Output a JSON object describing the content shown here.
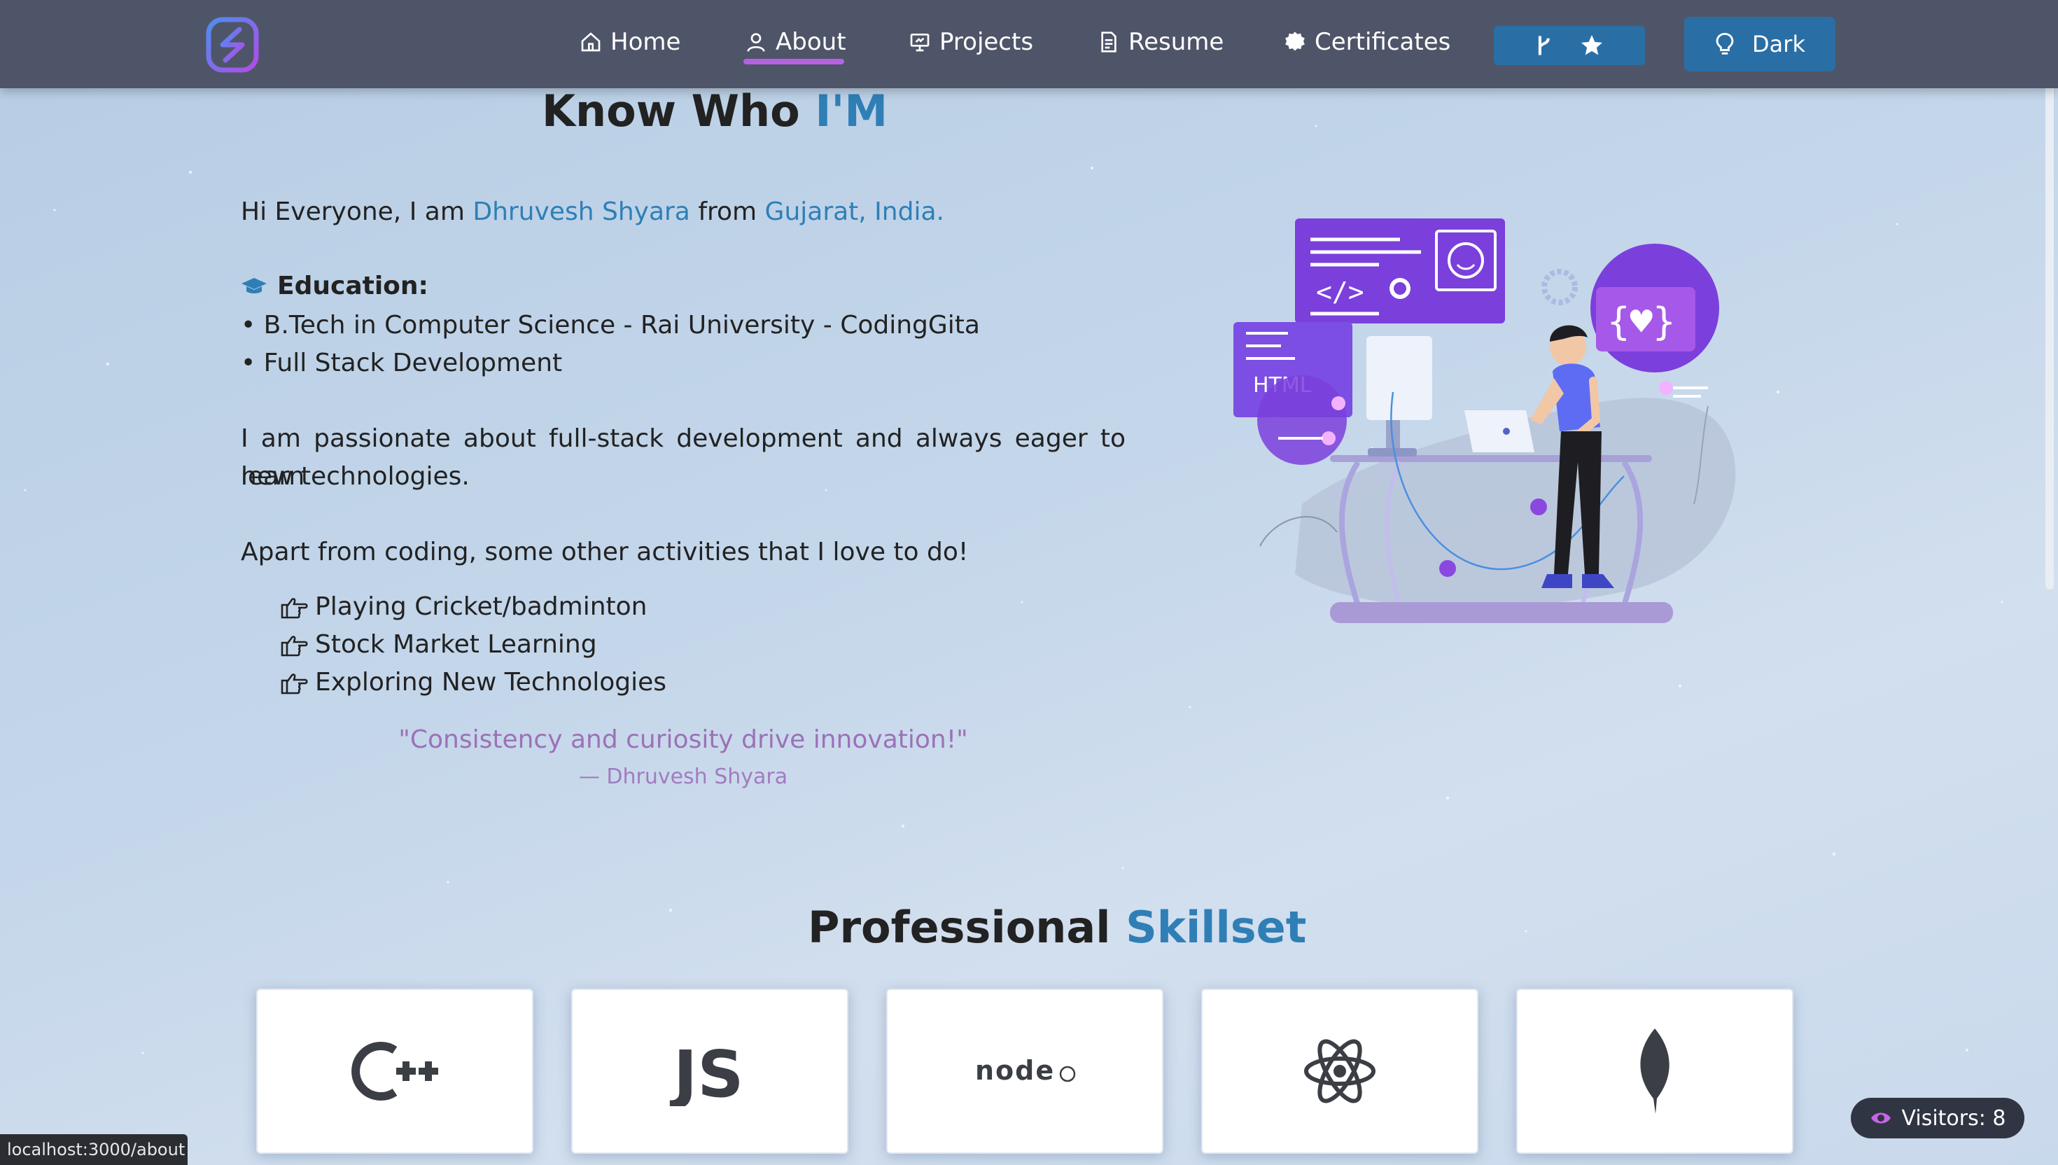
{
  "nav": {
    "home": "Home",
    "about": "About",
    "projects": "Projects",
    "resume": "Resume",
    "certificates": "Certificates",
    "theme_button": "Dark",
    "active": "About"
  },
  "about": {
    "title_plain": "Know Who ",
    "title_accent": "I'M",
    "intro_prefix": "Hi Everyone, I am ",
    "name": "Dhruvesh Shyara",
    "intro_mid": " from ",
    "location": "Gujarat, India.",
    "education_title": "Education:",
    "education_items": [
      "• B.Tech in Computer Science - Rai University - CodingGita",
      "• Full Stack Development"
    ],
    "passion_line1": "I am passionate about full-stack development and always eager to learn",
    "passion_line2": "new technologies.",
    "activities_intro": "Apart from coding, some other activities that I love to do!",
    "activities": [
      "Playing Cricket/badminton",
      "Stock Market Learning",
      "Exploring New Technologies"
    ],
    "quote": "\"Consistency and curiosity drive innovation!\"",
    "quote_author": "— Dhruvesh Shyara",
    "illustration_labels": {
      "html": "HTML"
    }
  },
  "skills": {
    "title_plain": "Professional ",
    "title_accent": "Skillset",
    "cards": [
      {
        "name": "C++",
        "icon": "cpp-icon"
      },
      {
        "name": "JS",
        "icon": "javascript-icon"
      },
      {
        "name": "node",
        "icon": "nodejs-icon"
      },
      {
        "name": "React",
        "icon": "react-icon"
      },
      {
        "name": "MongoDB",
        "icon": "mongodb-icon"
      }
    ]
  },
  "visitors": {
    "label": "Visitors: 8"
  },
  "status_bar": {
    "url": "localhost:3000/about"
  },
  "colors": {
    "accent": "#2f7fb6",
    "nav_bg": "#4f5568",
    "nav_underline": "#b562e0",
    "button_bg": "#2a6ea6",
    "quote": "#9b72b7"
  }
}
